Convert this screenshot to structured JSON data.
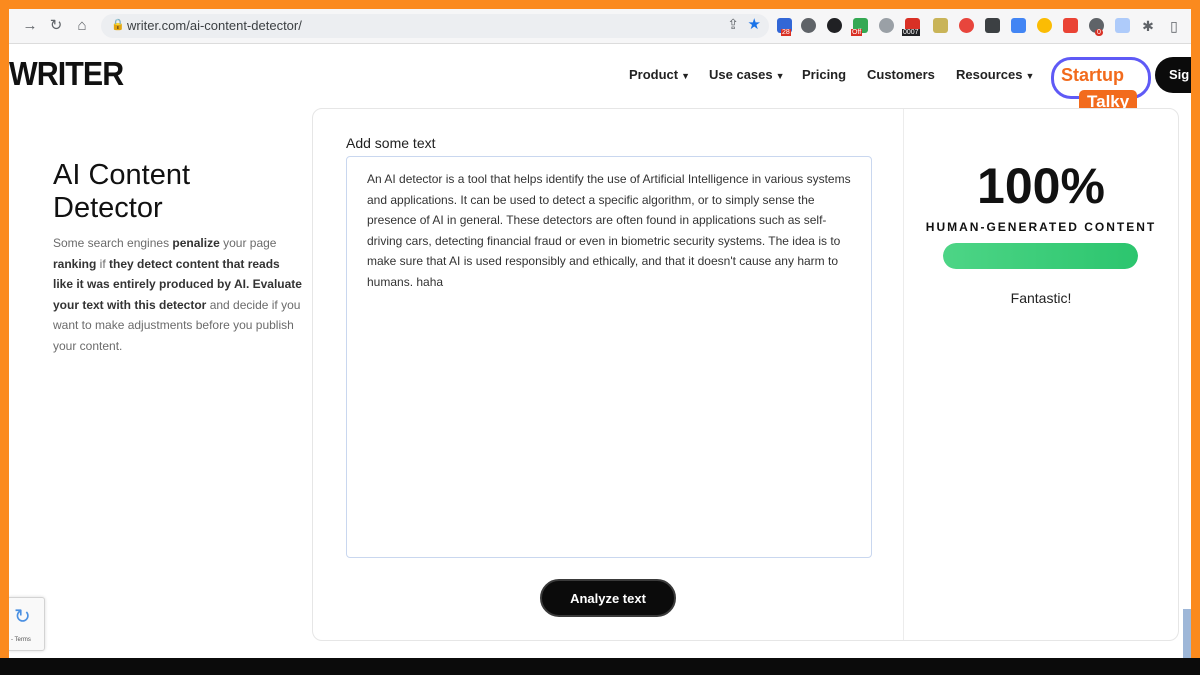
{
  "browser": {
    "url": "writer.com/ai-content-detector/",
    "extension_badges": [
      "28",
      "Off",
      "0007",
      "0"
    ]
  },
  "site": {
    "logo": "WRITER",
    "nav": [
      {
        "label": "Product"
      },
      {
        "label": "Use cases"
      },
      {
        "label": "Pricing"
      },
      {
        "label": "Customers"
      },
      {
        "label": "Resources"
      }
    ],
    "signup_label": "Sig"
  },
  "watermark": {
    "line1": "Startup",
    "line2": "Talky"
  },
  "hero": {
    "title": "AI Content Detector",
    "desc_1": "Some search engines ",
    "desc_b1": "penalize",
    "desc_2": " your page ",
    "desc_b2": "ranking",
    "desc_3": " if ",
    "desc_b3": "they detect content that reads like it was entirely produced by AI. Evaluate your text with this detector",
    "desc_4": " and decide if you want to make adjustments before you publish your content."
  },
  "detector": {
    "input_label": "Add some text",
    "input_value": "An AI detector is a tool that helps identify the use of Artificial Intelligence in various systems and applications. It can be used to detect a specific algorithm, or to simply sense the presence of AI in general. These detectors are often found in applications such as self-driving cars, detecting financial fraud or even in biometric security systems. The idea is to make sure that AI is used responsibly and ethically, and that it doesn't cause any harm to humans. haha",
    "analyze_label": "Analyze text"
  },
  "result": {
    "score": "100%",
    "score_fraction": 1.0,
    "label": "HUMAN-GENERATED CONTENT",
    "verdict": "Fantastic!"
  },
  "recaptcha": {
    "terms": "- Terms"
  },
  "colors": {
    "accent_green": "#2cc56e",
    "brand_orange": "#f26b1d",
    "badge_border": "#5f5af6"
  }
}
